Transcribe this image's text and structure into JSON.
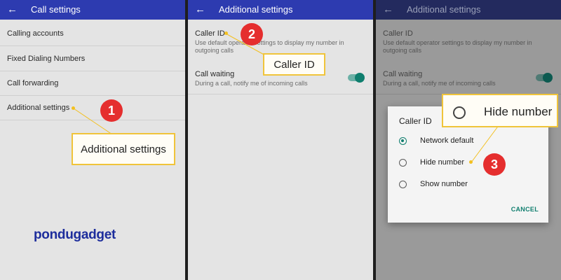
{
  "screens": [
    {
      "title": "Call settings",
      "items": [
        "Calling accounts",
        "Fixed Dialing Numbers",
        "Call forwarding",
        "Additional settings"
      ]
    },
    {
      "title": "Additional settings",
      "caller_id": {
        "label": "Caller ID",
        "description": "Use default operator settings to display my number in outgoing calls"
      },
      "call_waiting": {
        "label": "Call waiting",
        "description": "During a call, notify me of incoming calls",
        "enabled": true
      }
    },
    {
      "title": "Additional settings",
      "caller_id": {
        "label": "Caller ID",
        "description": "Use default operator settings to display my number in outgoing calls"
      },
      "call_waiting": {
        "label": "Call waiting",
        "description": "During a call, notify me of incoming calls",
        "enabled": true
      },
      "dialog": {
        "title": "Caller ID",
        "options": [
          "Network default",
          "Hide number",
          "Show number"
        ],
        "selected": "Network default",
        "cancel_label": "CANCEL"
      }
    }
  ],
  "callouts": [
    {
      "step": "1",
      "text": "Additional settings"
    },
    {
      "step": "2",
      "text": "Caller ID"
    },
    {
      "step": "3",
      "text": "Hide number"
    }
  ],
  "logo": {
    "text": "pondugadget"
  },
  "icons": {
    "back": "arrow-left-icon",
    "radio": "radio-button-icon"
  },
  "colors": {
    "appbar": "#2d3bb0",
    "accent": "#0f7e6e",
    "badge": "#e52e2e",
    "callout_border": "#f0c43a"
  }
}
